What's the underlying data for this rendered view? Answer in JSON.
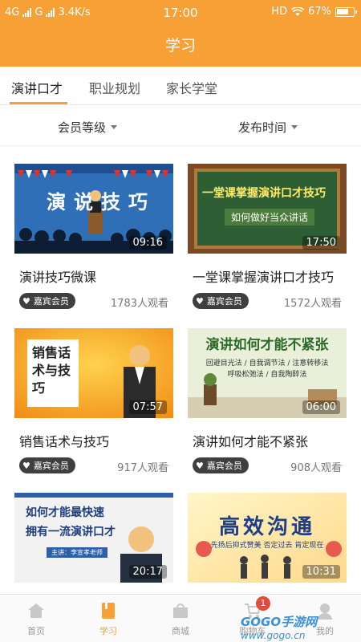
{
  "status_bar": {
    "network": "4G",
    "network2": "G",
    "speed": "3.4K/s",
    "time": "17:00",
    "hd": "HD",
    "battery": "67%"
  },
  "header": {
    "title": "学习"
  },
  "tabs": [
    {
      "label": "演讲口才",
      "active": true
    },
    {
      "label": "职业规划",
      "active": false
    },
    {
      "label": "家长学堂",
      "active": false
    }
  ],
  "filters": [
    {
      "label": "会员等级"
    },
    {
      "label": "发布时间"
    }
  ],
  "courses": [
    {
      "title": "演讲技巧微课",
      "duration": "09:16",
      "badge": "嘉宾会员",
      "views": "1783人观看",
      "thumb_text": "演说技巧"
    },
    {
      "title": "一堂课掌握演讲口才技巧",
      "duration": "17:50",
      "badge": "嘉宾会员",
      "views": "1572人观看",
      "thumb_text": "一堂课掌握演讲口才技巧",
      "thumb_sub": "如何做好当众讲话"
    },
    {
      "title": "销售话术与技巧",
      "duration": "07:57",
      "badge": "嘉宾会员",
      "views": "917人观看",
      "thumb_text": "销售话术与技巧"
    },
    {
      "title": "演讲如何才能不紧张",
      "duration": "06:00",
      "badge": "嘉宾会员",
      "views": "908人观看",
      "thumb_text": "演讲如何才能不紧张",
      "thumb_sub": "回避目光法 / 自我调节法 / 注意转移法",
      "thumb_sub2": "呼吸松弛法 / 自我陶醉法"
    },
    {
      "title": "",
      "duration": "20:17",
      "badge": "",
      "views": "",
      "thumb_text": "如何才能最快速",
      "thumb_text2": "拥有一流演讲口才",
      "thumb_sub": "主讲：李宣孝老师"
    },
    {
      "title": "",
      "duration": "10:31",
      "badge": "",
      "views": "",
      "thumb_text": "高效沟通",
      "thumb_sub": "先扬后抑式赞美  否定过去  肯定现在"
    }
  ],
  "bottom_nav": [
    {
      "label": "首页",
      "icon": "home-icon",
      "active": false
    },
    {
      "label": "学习",
      "icon": "book-icon",
      "active": true
    },
    {
      "label": "商城",
      "icon": "shop-icon",
      "active": false
    },
    {
      "label": "购物车",
      "icon": "cart-icon",
      "active": false,
      "badge": "1"
    },
    {
      "label": "我的",
      "icon": "profile-icon",
      "active": false
    }
  ],
  "watermark": {
    "text": "GOGO手游网",
    "sub": "www.gogo.cn"
  },
  "colors": {
    "accent": "#f7a035",
    "badge_bg": "#3f3f3f",
    "cart_badge": "#e54b3c"
  }
}
